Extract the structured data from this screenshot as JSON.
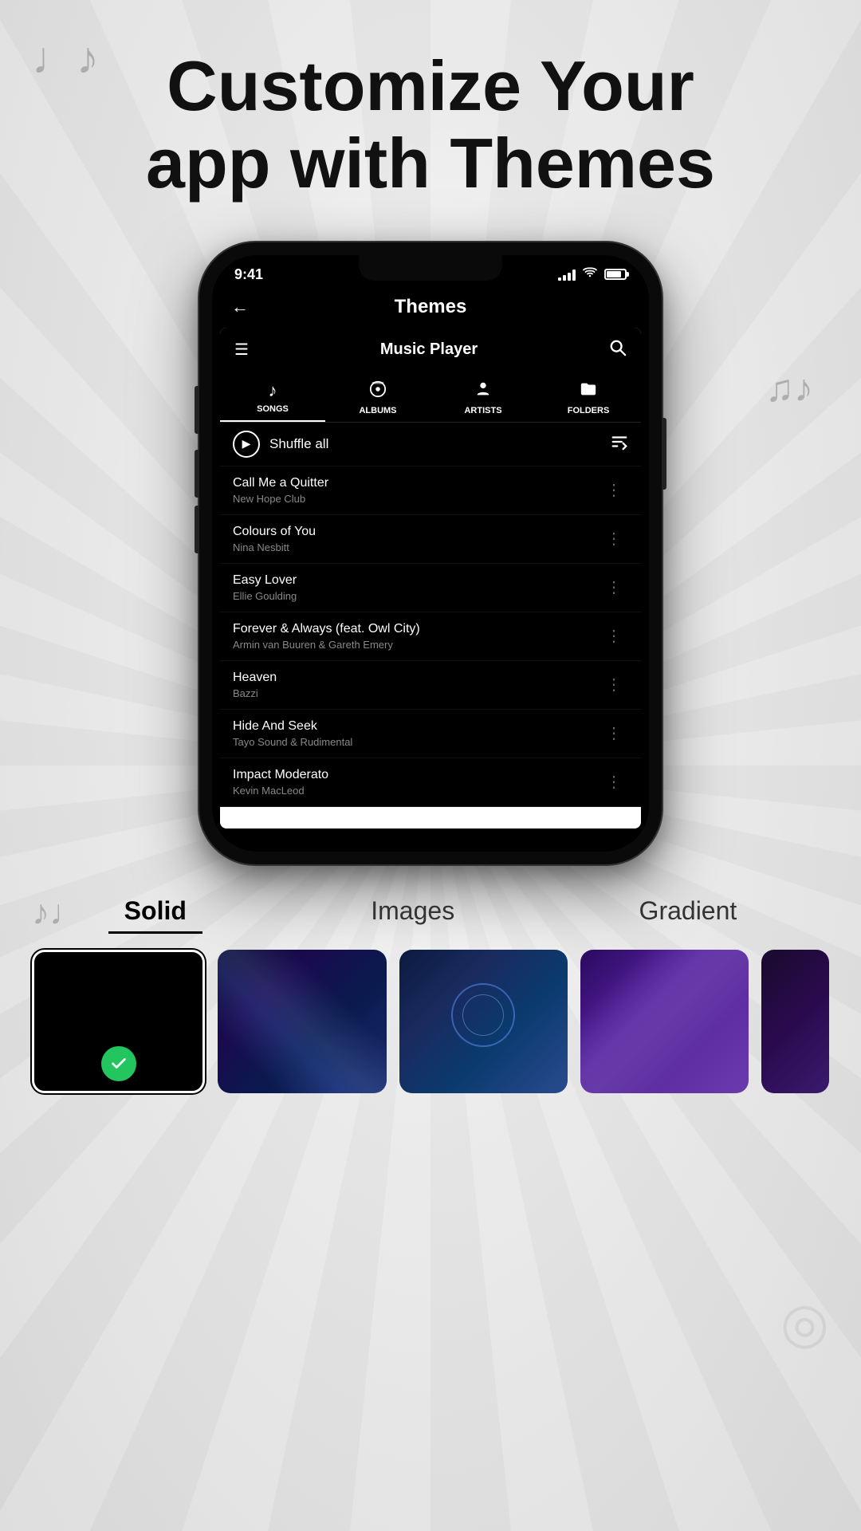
{
  "header": {
    "title_line1": "Customize Your",
    "title_line2": "app with Themes"
  },
  "phone": {
    "status": {
      "time": "9:41"
    },
    "themes_title": "Themes",
    "app": {
      "title": "Music Player",
      "tabs": [
        {
          "label": "SONGS",
          "icon": "♪",
          "active": true
        },
        {
          "label": "ALBUMS",
          "icon": "📀",
          "active": false
        },
        {
          "label": "ARTISTS",
          "icon": "👤",
          "active": false
        },
        {
          "label": "FOLDERS",
          "icon": "📁",
          "active": false
        }
      ],
      "shuffle_label": "Shuffle all",
      "songs": [
        {
          "title": "Call Me a Quitter",
          "artist": "New Hope Club"
        },
        {
          "title": "Colours of You",
          "artist": "Nina Nesbitt"
        },
        {
          "title": "Easy Lover",
          "artist": "Ellie Goulding"
        },
        {
          "title": "Forever & Always (feat. Owl City)",
          "artist": "Armin van Buuren & Gareth Emery"
        },
        {
          "title": "Heaven",
          "artist": "Bazzi"
        },
        {
          "title": "Hide And Seek",
          "artist": "Tayo Sound & Rudimental"
        },
        {
          "title": "Impact Moderato",
          "artist": "Kevin MacLeod"
        }
      ]
    }
  },
  "themes": {
    "tabs": [
      {
        "label": "Solid",
        "active": true
      },
      {
        "label": "Images",
        "active": false
      },
      {
        "label": "Gradient",
        "active": false
      }
    ],
    "cards": [
      {
        "type": "solid",
        "selected": true
      },
      {
        "type": "blue"
      },
      {
        "type": "cosmic"
      },
      {
        "type": "purple"
      },
      {
        "type": "dark"
      }
    ]
  }
}
